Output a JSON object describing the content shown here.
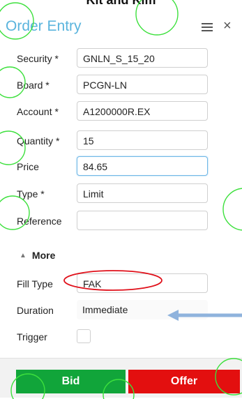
{
  "caption": "Kit and Kim",
  "window": {
    "title": "Order Entry",
    "menu_icon": "hamburger-icon",
    "close_icon": "close-icon",
    "close_glyph": "×"
  },
  "fields": {
    "security": {
      "label": "Security *",
      "value": "GNLN_S_15_20"
    },
    "board": {
      "label": "Board *",
      "value": "PCGN-LN"
    },
    "account": {
      "label": "Account *",
      "value": "A1200000R.EX"
    },
    "quantity": {
      "label": "Quantity *",
      "value": "15"
    },
    "price": {
      "label": "Price",
      "value": "84.65"
    },
    "type": {
      "label": "Type *",
      "value": "Limit"
    },
    "reference": {
      "label": "Reference",
      "value": ""
    }
  },
  "more": {
    "label": "More",
    "icon": "triangle-up-icon",
    "glyph": "▲"
  },
  "advanced": {
    "fill_type": {
      "label": "Fill Type",
      "value": "FAK"
    },
    "duration": {
      "label": "Duration",
      "value": "Immediate"
    },
    "trigger": {
      "label": "Trigger"
    }
  },
  "buttons": {
    "bid": "Bid",
    "offer": "Offer"
  },
  "colors": {
    "title": "#5ab4dd",
    "bid": "#11a53a",
    "offer": "#e30f0f",
    "annotation_red": "#e0101a",
    "annotation_green": "#3de03d",
    "arrow": "#8fb3dd"
  }
}
